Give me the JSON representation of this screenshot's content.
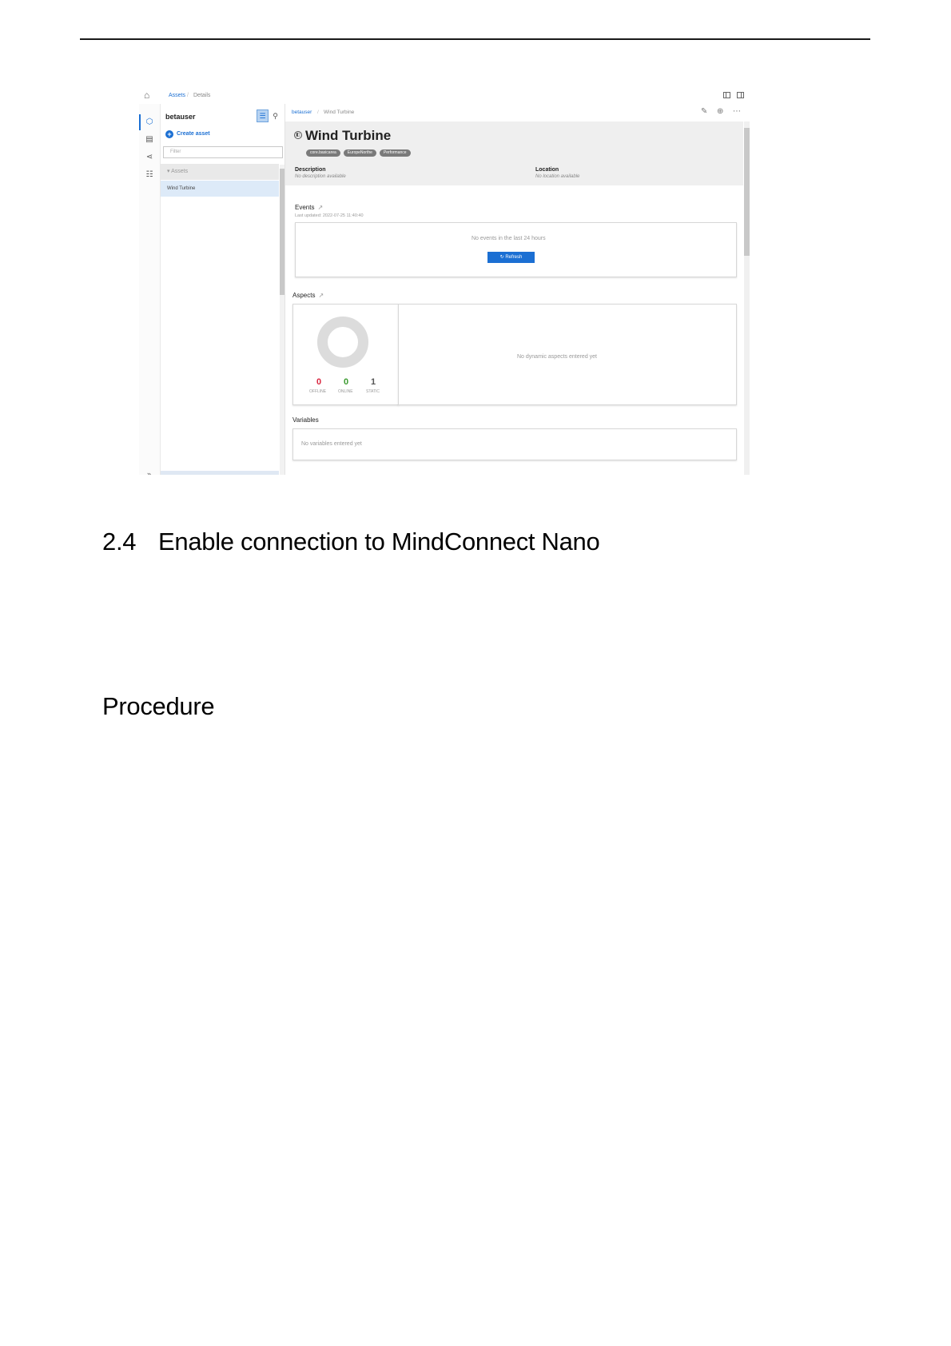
{
  "header_rule": true,
  "screenshot": {
    "topbar": {
      "breadcrumb_1": "Assets",
      "breadcrumb_sep": "/",
      "breadcrumb_2": "Details"
    },
    "rail": {
      "icons": [
        "assets-icon",
        "dashboard-icon",
        "share-icon",
        "hierarchy-icon"
      ],
      "expand": "»"
    },
    "tree": {
      "user": "betauser",
      "create": "Create asset",
      "filter_placeholder": "Filter",
      "assets_header": "▾ Assets",
      "item": "Wind Turbine"
    },
    "main": {
      "breadcrumb_1": "betauser",
      "breadcrumb_sep": "/",
      "breadcrumb_2": "Wind Turbine",
      "title": "Wind Turbine",
      "chips": [
        "core.basicarea",
        "EuropeNorthe",
        "Performance"
      ],
      "description_label": "Description",
      "description_value": "No description available",
      "location_label": "Location",
      "location_value": "No location available",
      "events_label": "Events",
      "events_updated": "Last updated: 2022-07-25 11:40:40",
      "events_empty": "No events in the last 24 hours",
      "refresh": "Refresh",
      "aspects_label": "Aspects",
      "aspects_empty": "No dynamic aspects entered yet",
      "stats": [
        {
          "value": "0",
          "label": "OFFLINE",
          "color": "#d9263f"
        },
        {
          "value": "0",
          "label": "ONLINE",
          "color": "#3a9a2e"
        },
        {
          "value": "1",
          "label": "STATIC",
          "color": "#555555"
        }
      ],
      "variables_label": "Variables",
      "variables_empty": "No variables entered yet"
    }
  },
  "section": {
    "number": "2.4",
    "title": "Enable connection to MindConnect Nano"
  },
  "subsection": {
    "title": "Procedure"
  }
}
